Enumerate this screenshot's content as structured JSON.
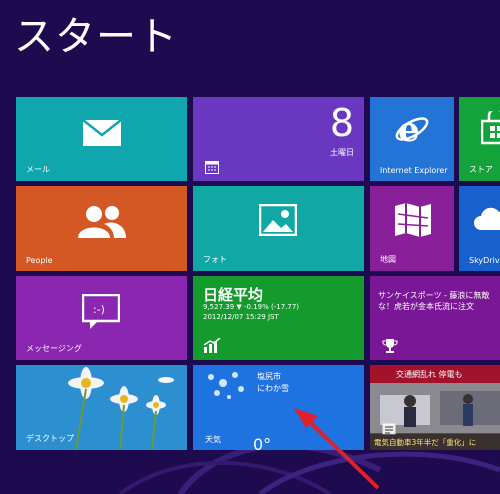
{
  "screen": {
    "title": "スタート"
  },
  "tiles": {
    "mail": {
      "label": "メール"
    },
    "people": {
      "label": "People"
    },
    "messaging": {
      "label": "メッセージング"
    },
    "desktop": {
      "label": "デスクトップ"
    },
    "calendar": {
      "date": "8",
      "weekday": "土曜日"
    },
    "photos": {
      "label": "フォト"
    },
    "finance": {
      "title": "日経平均",
      "quote": "9,527.39  ▼ -0.19% (-17.77)",
      "timestamp": "2012/12/07 15:29 JST"
    },
    "weather": {
      "city": "塩尻市",
      "condition": "にわか雪",
      "label": "天気",
      "temp": "0°"
    },
    "ie": {
      "label": "Internet Explorer"
    },
    "store": {
      "label": "ストア"
    },
    "maps": {
      "label": "地図"
    },
    "skydrive": {
      "label": "SkyDrive"
    },
    "sports": {
      "headline": "サンケイスポーツ - 藤浪に無敵な！虎若が金本氏流に注文"
    },
    "news": {
      "headline": "交通網乱れ 停電も",
      "caption": "電気自動車3年半だ「重化」に"
    }
  },
  "colors": {
    "background": "#1e0a4e",
    "mail": "#0fa6ad",
    "people": "#d35823",
    "messaging": "#8b26b0",
    "desktop": "#2c8fcf",
    "calendar": "#6a38c0",
    "photos": "#11a7a5",
    "finance": "#149a2d",
    "weather": "#1e73e0",
    "ie": "#2473d6",
    "store": "#14a23b",
    "maps": "#8a1f9a",
    "skydrive": "#1860cc",
    "sports": "#7a1797",
    "annotation_arrow": "#e0202a"
  }
}
